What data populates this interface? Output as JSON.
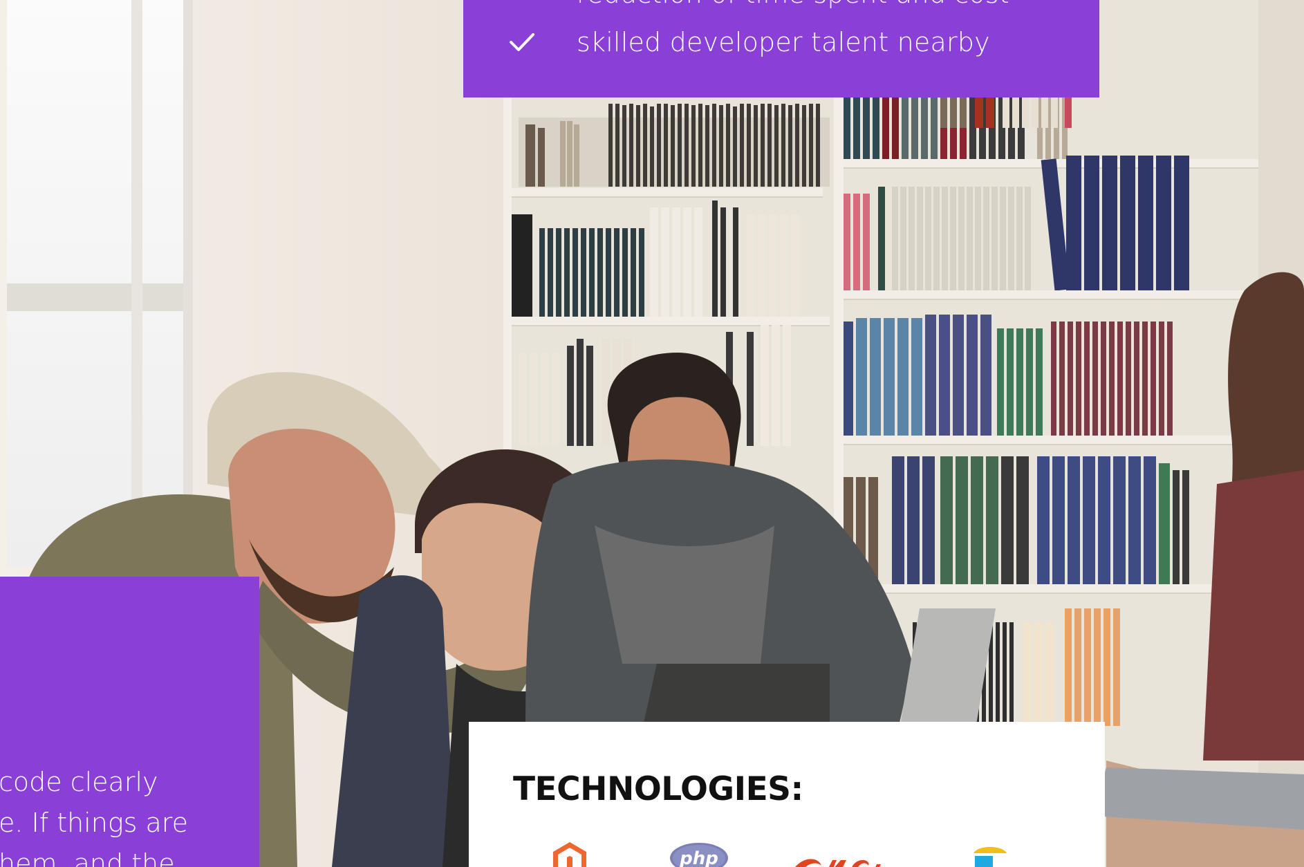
{
  "features": {
    "items": [
      {
        "icon": "check-icon",
        "text": "reduction of time spent and cost"
      },
      {
        "icon": "check-icon",
        "text": "skilled developer talent nearby"
      }
    ]
  },
  "left_panel": {
    "lines": [
      "code clearly",
      "e. If things are",
      "hem, and the"
    ]
  },
  "technologies": {
    "title": "TECHNOLOGIES:",
    "logos": [
      "magento-logo-icon",
      "php-logo-icon",
      "shopware-logo-icon",
      "elastic-logo-icon"
    ]
  },
  "colors": {
    "accent_purple": "#8a3fd6",
    "card_white": "#ffffff",
    "title_black": "#111111"
  }
}
